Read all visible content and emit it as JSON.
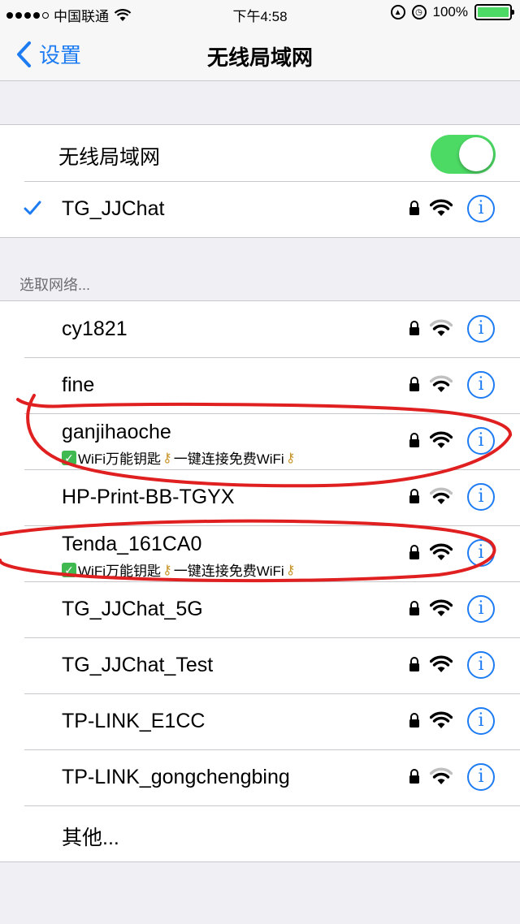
{
  "status_bar": {
    "carrier": "中国联通",
    "time": "下午4:58",
    "battery_percent": "100%",
    "battery_level": 1.0,
    "colors": {
      "battery": "#4cd964"
    }
  },
  "nav": {
    "back_label": "设置",
    "title": "无线局域网"
  },
  "wifi_toggle": {
    "label": "无线局域网",
    "on": true
  },
  "connected": {
    "ssid": "TG_JJChat",
    "locked": true,
    "signal": 3
  },
  "section_header": "选取网络...",
  "networks": [
    {
      "ssid": "cy1821",
      "sub": "",
      "locked": true,
      "signal": 2
    },
    {
      "ssid": "fine",
      "sub": "",
      "locked": true,
      "signal": 2
    },
    {
      "ssid": "ganjihaoche",
      "sub": "WiFi万能钥匙",
      "sub2": "一键连接免费WiFi",
      "locked": true,
      "signal": 3
    },
    {
      "ssid": "HP-Print-BB-TGYX",
      "sub": "",
      "locked": true,
      "signal": 2
    },
    {
      "ssid": "Tenda_161CA0",
      "sub": "WiFi万能钥匙",
      "sub2": "一键连接免费WiFi",
      "locked": true,
      "signal": 3
    },
    {
      "ssid": "TG_JJChat_5G",
      "sub": "",
      "locked": true,
      "signal": 3
    },
    {
      "ssid": "TG_JJChat_Test",
      "sub": "",
      "locked": true,
      "signal": 3
    },
    {
      "ssid": "TP-LINK_E1CC",
      "sub": "",
      "locked": true,
      "signal": 3
    },
    {
      "ssid": "TP-LINK_gongchengbing",
      "sub": "",
      "locked": true,
      "signal": 2
    }
  ],
  "other_label": "其他...",
  "info_glyph": "i",
  "colors": {
    "accent": "#1e7cf3",
    "toggle_on": "#4cd964",
    "annotation": "#e02020"
  }
}
